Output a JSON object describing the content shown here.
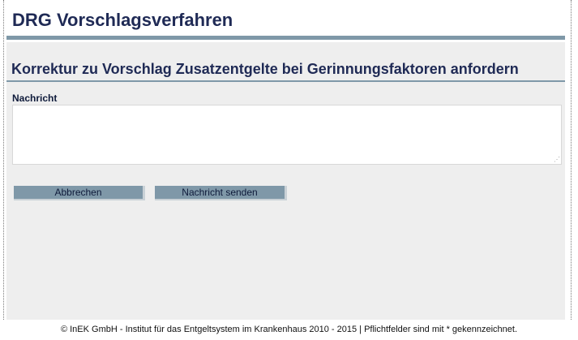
{
  "header": {
    "title": "DRG Vorschlagsverfahren"
  },
  "form": {
    "title": "Korrektur zu Vorschlag Zusatzentgelte bei Gerinnungsfaktoren anfordern",
    "message_label": "Nachricht",
    "message_value": "",
    "cancel_label": "Abbrechen",
    "send_label": "Nachricht senden"
  },
  "footer": {
    "text": "© InEK GmbH - Institut für das Entgeltsystem im Krankenhaus 2010 - 2015 | Pflichtfelder sind mit * gekennzeichnet."
  },
  "colors": {
    "accent": "#7f98a8",
    "panel_bg": "#eeeeee",
    "title_text": "#1f2a55"
  }
}
